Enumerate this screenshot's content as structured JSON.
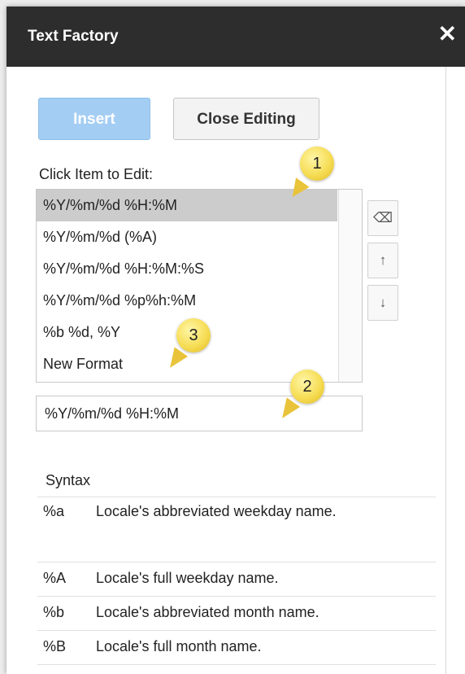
{
  "window": {
    "title": "Text Factory",
    "close_glyph": "✕"
  },
  "toolbar": {
    "insert_label": "Insert",
    "close_editing_label": "Close Editing"
  },
  "list": {
    "label": "Click Item to Edit:",
    "items": [
      {
        "text": "%Y/%m/%d %H:%M",
        "selected": true
      },
      {
        "text": "%Y/%m/%d (%A)"
      },
      {
        "text": "%Y/%m/%d %H:%M:%S"
      },
      {
        "text": "%Y/%m/%d %p%h:%M"
      },
      {
        "text": "%b %d, %Y"
      },
      {
        "text": "New Format"
      }
    ]
  },
  "side_buttons": {
    "delete": "⌫",
    "up": "↑",
    "down": "↓"
  },
  "editor": {
    "value": "%Y/%m/%d %H:%M"
  },
  "syntax": {
    "title": "Syntax",
    "rows": [
      {
        "code": "%a",
        "desc": "Locale's abbreviated weekday name."
      },
      {
        "code": "%A",
        "desc": "Locale's full weekday name."
      },
      {
        "code": "%b",
        "desc": "Locale's abbreviated month name."
      },
      {
        "code": "%B",
        "desc": "Locale's full month name."
      }
    ]
  },
  "callouts": [
    "1",
    "2",
    "3"
  ],
  "colors": {
    "titlebar": "#2d2d2d",
    "insert_button": "#a3cdf3",
    "selected_row": "#cccccc",
    "callout": "#f6dd55"
  }
}
